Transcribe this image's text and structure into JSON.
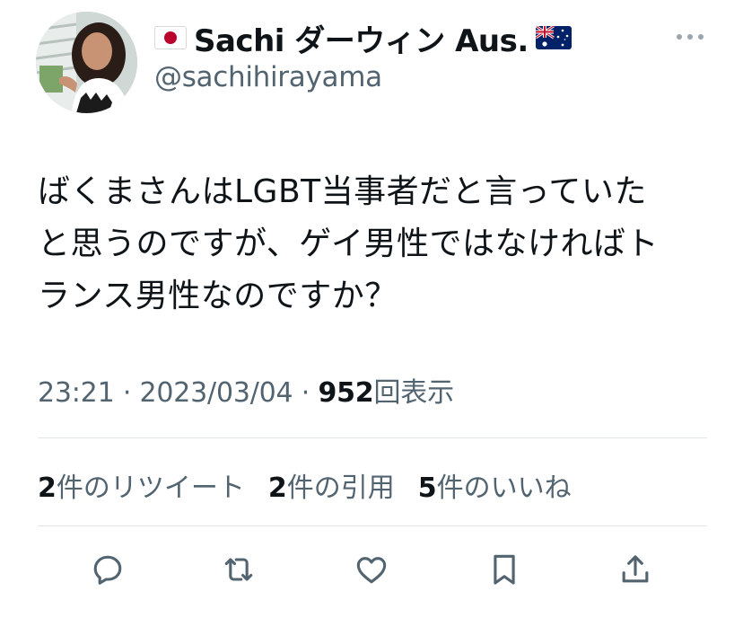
{
  "user": {
    "display_name": "Sachi ダーウィン Aus.",
    "handle": "@sachihirayama",
    "flag_left": "japan-flag-icon",
    "flag_right": "australia-flag-icon"
  },
  "tweet": {
    "lines": [
      "ばくまさんはLGBT当事者だと言っていた",
      "と思うのですが、ゲイ男性ではなければト",
      "ランス男性なのですか？"
    ]
  },
  "meta": {
    "time": "23:21",
    "separator": "·",
    "date": "2023/03/04",
    "views_count": "952",
    "views_label": "回表示"
  },
  "stats": [
    {
      "count": "2",
      "label": "件のリツイート"
    },
    {
      "count": "2",
      "label": "件の引用"
    },
    {
      "count": "5",
      "label": "件のいいね"
    }
  ],
  "actions": [
    {
      "icon": "reply-icon"
    },
    {
      "icon": "retweet-icon"
    },
    {
      "icon": "like-icon"
    },
    {
      "icon": "bookmark-icon"
    },
    {
      "icon": "share-icon"
    }
  ],
  "colors": {
    "text_primary": "#0f1419",
    "text_secondary": "#536471",
    "divider": "#e1e5e8",
    "icon": "#536471"
  }
}
